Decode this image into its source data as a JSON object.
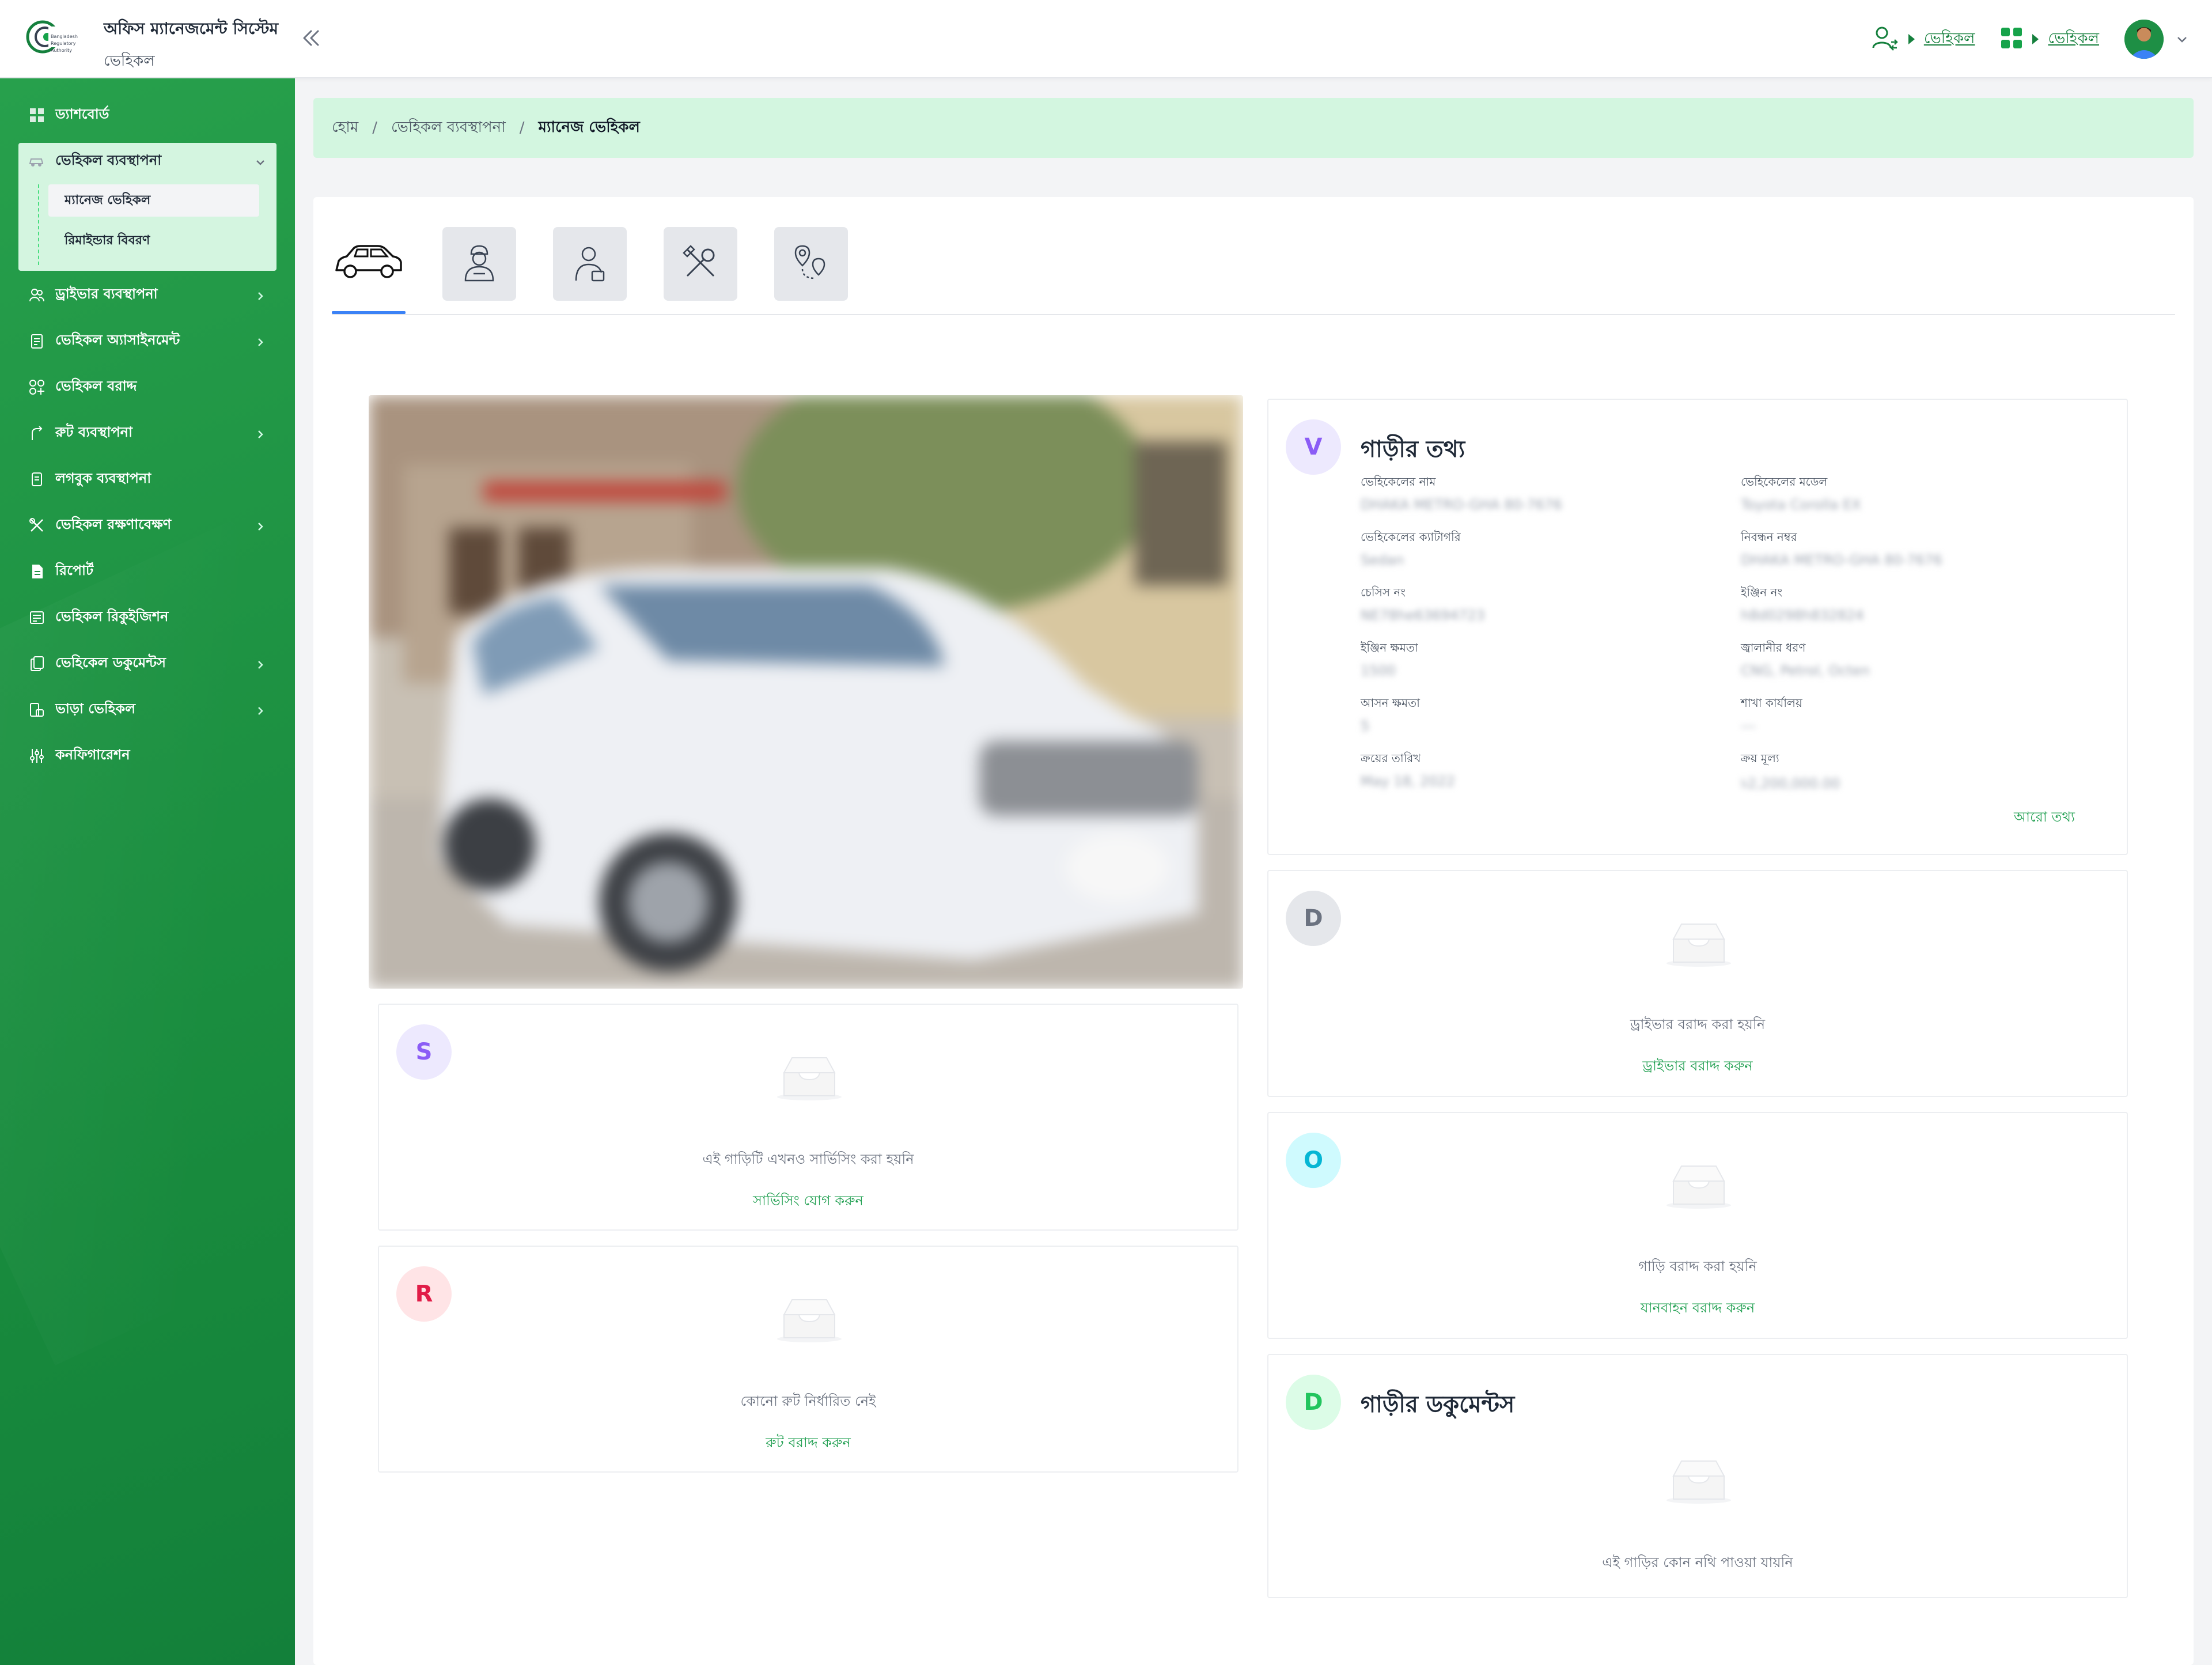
{
  "header": {
    "system_name": "অফিস ম্যানেজমেন্ট সিস্টেম",
    "module_name": "ভেহিকল",
    "logo_text": [
      "Bangladesh",
      "Regulatory",
      "Authority"
    ],
    "links": [
      {
        "label": "ভেহিকল",
        "icon": "user-swap-icon"
      },
      {
        "label": "ভেহিকল",
        "icon": "grid-apps-icon"
      }
    ]
  },
  "sidebar": {
    "items": [
      {
        "label": "ড্যাশবোর্ড",
        "icon": "dashboard-icon",
        "has_children": false
      },
      {
        "label": "ভেহিকল ব্যবস্থাপনা",
        "icon": "car-icon",
        "has_children": true,
        "expanded": true
      },
      {
        "label": "ড্রাইভার ব্যবস্থাপনা",
        "icon": "users-icon",
        "has_children": true
      },
      {
        "label": "ভেহিকল অ্যাসাইনমেন্ট",
        "icon": "clipboard-icon",
        "has_children": true
      },
      {
        "label": "ভেহিকল বরাদ্দ",
        "icon": "apps-add-icon",
        "has_children": false
      },
      {
        "label": "রুট ব্যবস্থাপনা",
        "icon": "route-icon",
        "has_children": true
      },
      {
        "label": "লগবুক ব্যবস্থাপনা",
        "icon": "logbook-icon",
        "has_children": false
      },
      {
        "label": "ভেহিকল রক্ষণাবেক্ষণ",
        "icon": "tools-icon",
        "has_children": true
      },
      {
        "label": "রিপোর্ট",
        "icon": "report-icon",
        "has_children": false
      },
      {
        "label": "ভেহিকল রিকুইজিশন",
        "icon": "requisition-icon",
        "has_children": false
      },
      {
        "label": "ভেহিকেল ডকুমেন্টস",
        "icon": "documents-icon",
        "has_children": true
      },
      {
        "label": "ভাড়া ভেহিকল",
        "icon": "rent-icon",
        "has_children": true
      },
      {
        "label": "কনফিগারেশন",
        "icon": "config-icon",
        "has_children": false
      }
    ],
    "submenu": [
      {
        "label": "ম্যানেজ ভেহিকল",
        "active": true
      },
      {
        "label": "রিমাইন্ডার বিবরণ",
        "active": false
      }
    ]
  },
  "breadcrumb": {
    "home": "হোম",
    "section": "ভেহিকল ব্যবস্থাপনা",
    "current": "ম্যানেজ ভেহিকল"
  },
  "tabs": [
    {
      "icon": "car-icon",
      "active": true
    },
    {
      "icon": "driver-icon",
      "active": false
    },
    {
      "icon": "assigned-person-icon",
      "active": false
    },
    {
      "icon": "tools-icon",
      "active": false
    },
    {
      "icon": "route-pin-icon",
      "active": false
    }
  ],
  "vehicle_info": {
    "letter": "V",
    "title": "গাড়ীর তথ্য",
    "fields": [
      {
        "label": "ভেহিকেলের নাম",
        "value": "DHAKA METRO-GHA 80-7676"
      },
      {
        "label": "ভেহিকেলের মডেল",
        "value": "Toyota Corolla EX"
      },
      {
        "label": "ভেহিকেলের ক্যাটাগরি",
        "value": "Sedan"
      },
      {
        "label": "নিবন্ধন নম্বর",
        "value": "DHAKA METRO-GHA 80-7676"
      },
      {
        "label": "চেসিস নং",
        "value": "NE78he63694723"
      },
      {
        "label": "ইঞ্জিন নং",
        "value": "h8d0298h832824"
      },
      {
        "label": "ইঞ্জিন ক্ষমতা",
        "value": "1500"
      },
      {
        "label": "জ্বালানীর ধরণ",
        "value": "CNG, Petrol, Octen"
      },
      {
        "label": "আসন ক্ষমতা",
        "value": "5"
      },
      {
        "label": "শাখা কার্যালয়",
        "value": "---"
      },
      {
        "label": "ক্রয়ের তারিখ",
        "value": "May 18, 2022"
      },
      {
        "label": "ক্রয় মূল্য",
        "value": "৳2,200,000.00"
      }
    ],
    "more_link": "আরো তথ্য"
  },
  "driver_card": {
    "letter": "D",
    "empty_text": "ড্রাইভার বরাদ্দ করা হয়নি",
    "action": "ড্রাইভার বরাদ্দ করুন"
  },
  "office_card": {
    "letter": "O",
    "empty_text": "গাড়ি বরাদ্দ করা হয়নি",
    "action": "যানবাহন বরাদ্দ করুন"
  },
  "documents_card": {
    "letter": "D",
    "title": "গাড়ীর ডকুমেন্টস",
    "empty_text": "এই গাড়ির কোন নথি পাওয়া যায়নি"
  },
  "service_card": {
    "letter": "S",
    "empty_text": "এই গাড়িটি এখনও সার্ভিসিং করা হয়নি",
    "action": "সার্ভিসিং যোগ করুন"
  },
  "route_card": {
    "letter": "R",
    "empty_text": "কোনো রুট নির্ধারিত নেই",
    "action": "রুট বরাদ্দ করুন"
  },
  "colors": {
    "sidebar_green": "#1f9444",
    "breadcrumb_bg": "#d3f6e0",
    "accent_link": "#22a052",
    "tab_underline": "#3b82f6",
    "letter_v": "#8b5cf6",
    "letter_d_grey": "#6b7280",
    "letter_o": "#06b6d4",
    "letter_d_green": "#22c55e",
    "letter_s": "#8b5cf6",
    "letter_r": "#e11d48"
  }
}
